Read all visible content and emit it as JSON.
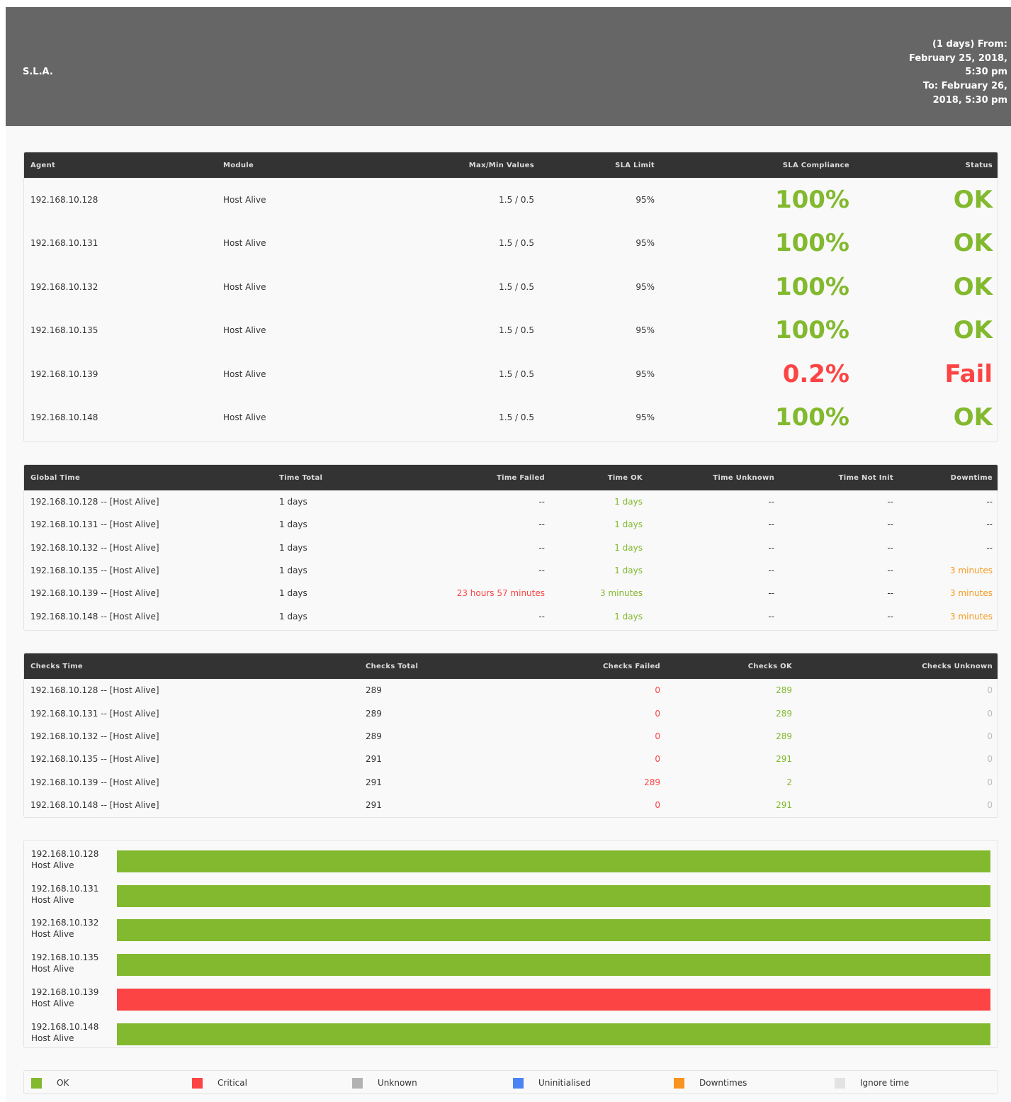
{
  "header": {
    "title": "S.L.A.",
    "range_lines": [
      "(1 days) From:",
      "February 25, 2018,",
      "5:30 pm",
      "To: February 26,",
      "2018, 5:30 pm"
    ]
  },
  "colors": {
    "ok": "#82b92e",
    "critical": "#fc4444",
    "unknown": "#b2b2b2",
    "uninitialised": "#4a83f3",
    "downtimes": "#f7931e",
    "ignore": "#e3e3e3"
  },
  "sla_table": {
    "headers": [
      "Agent",
      "Module",
      "Max/Min Values",
      "SLA Limit",
      "SLA Compliance",
      "Status"
    ],
    "rows": [
      {
        "agent": "192.168.10.128",
        "module": "Host Alive",
        "maxmin": "1.5 / 0.5",
        "limit": "95%",
        "compliance": "100%",
        "status": "OK",
        "state": "ok"
      },
      {
        "agent": "192.168.10.131",
        "module": "Host Alive",
        "maxmin": "1.5 / 0.5",
        "limit": "95%",
        "compliance": "100%",
        "status": "OK",
        "state": "ok"
      },
      {
        "agent": "192.168.10.132",
        "module": "Host Alive",
        "maxmin": "1.5 / 0.5",
        "limit": "95%",
        "compliance": "100%",
        "status": "OK",
        "state": "ok"
      },
      {
        "agent": "192.168.10.135",
        "module": "Host Alive",
        "maxmin": "1.5 / 0.5",
        "limit": "95%",
        "compliance": "100%",
        "status": "OK",
        "state": "ok"
      },
      {
        "agent": "192.168.10.139",
        "module": "Host Alive",
        "maxmin": "1.5 / 0.5",
        "limit": "95%",
        "compliance": "0.2%",
        "status": "Fail",
        "state": "fail"
      },
      {
        "agent": "192.168.10.148",
        "module": "Host Alive",
        "maxmin": "1.5 / 0.5",
        "limit": "95%",
        "compliance": "100%",
        "status": "OK",
        "state": "ok"
      }
    ]
  },
  "time_table": {
    "headers": [
      "Global Time",
      "Time Total",
      "Time Failed",
      "Time OK",
      "Time Unknown",
      "Time Not Init",
      "Downtime"
    ],
    "rows": [
      {
        "name": "192.168.10.128 -- [Host Alive]",
        "total": "1 days",
        "failed": "--",
        "ok": "1 days",
        "unknown": "--",
        "notinit": "--",
        "downtime": "--"
      },
      {
        "name": "192.168.10.131 -- [Host Alive]",
        "total": "1 days",
        "failed": "--",
        "ok": "1 days",
        "unknown": "--",
        "notinit": "--",
        "downtime": "--"
      },
      {
        "name": "192.168.10.132 -- [Host Alive]",
        "total": "1 days",
        "failed": "--",
        "ok": "1 days",
        "unknown": "--",
        "notinit": "--",
        "downtime": "--"
      },
      {
        "name": "192.168.10.135 -- [Host Alive]",
        "total": "1 days",
        "failed": "--",
        "ok": "1 days",
        "unknown": "--",
        "notinit": "--",
        "downtime": "3 minutes"
      },
      {
        "name": "192.168.10.139 -- [Host Alive]",
        "total": "1 days",
        "failed": "23 hours 57 minutes",
        "ok": "3 minutes",
        "unknown": "--",
        "notinit": "--",
        "downtime": "3 minutes"
      },
      {
        "name": "192.168.10.148 -- [Host Alive]",
        "total": "1 days",
        "failed": "--",
        "ok": "1 days",
        "unknown": "--",
        "notinit": "--",
        "downtime": "3 minutes"
      }
    ]
  },
  "checks_table": {
    "headers": [
      "Checks Time",
      "Checks Total",
      "Checks Failed",
      "Checks OK",
      "Checks Unknown"
    ],
    "rows": [
      {
        "name": "192.168.10.128 -- [Host Alive]",
        "total": "289",
        "failed": "0",
        "ok": "289",
        "unknown": "0"
      },
      {
        "name": "192.168.10.131 -- [Host Alive]",
        "total": "289",
        "failed": "0",
        "ok": "289",
        "unknown": "0"
      },
      {
        "name": "192.168.10.132 -- [Host Alive]",
        "total": "289",
        "failed": "0",
        "ok": "289",
        "unknown": "0"
      },
      {
        "name": "192.168.10.135 -- [Host Alive]",
        "total": "291",
        "failed": "0",
        "ok": "291",
        "unknown": "0"
      },
      {
        "name": "192.168.10.139 -- [Host Alive]",
        "total": "291",
        "failed": "289",
        "ok": "2",
        "unknown": "0"
      },
      {
        "name": "192.168.10.148 -- [Host Alive]",
        "total": "291",
        "failed": "0",
        "ok": "291",
        "unknown": "0"
      }
    ]
  },
  "bars": [
    {
      "agent": "192.168.10.128",
      "module": "Host Alive",
      "state": "ok"
    },
    {
      "agent": "192.168.10.131",
      "module": "Host Alive",
      "state": "ok"
    },
    {
      "agent": "192.168.10.132",
      "module": "Host Alive",
      "state": "ok"
    },
    {
      "agent": "192.168.10.135",
      "module": "Host Alive",
      "state": "ok"
    },
    {
      "agent": "192.168.10.139",
      "module": "Host Alive",
      "state": "critical"
    },
    {
      "agent": "192.168.10.148",
      "module": "Host Alive",
      "state": "ok"
    }
  ],
  "legend": [
    {
      "label": "OK",
      "color_key": "ok"
    },
    {
      "label": "Critical",
      "color_key": "critical"
    },
    {
      "label": "Unknown",
      "color_key": "unknown"
    },
    {
      "label": "Uninitialised",
      "color_key": "uninitialised"
    },
    {
      "label": "Downtimes",
      "color_key": "downtimes"
    },
    {
      "label": "Ignore time",
      "color_key": "ignore"
    }
  ]
}
